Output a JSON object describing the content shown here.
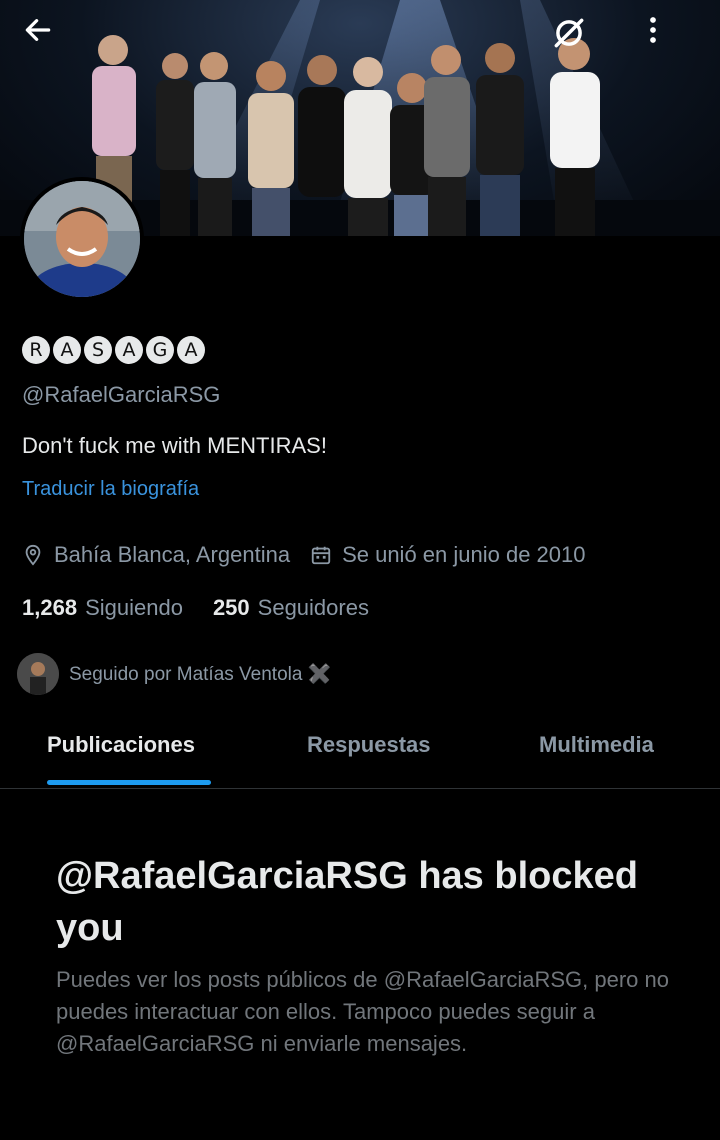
{
  "header": {
    "back_icon": "arrow-left-icon",
    "translate_icon": "translate-slash-icon",
    "more_icon": "more-vertical-icon"
  },
  "profile": {
    "display_name_letters": [
      "R",
      "A",
      "S",
      "A",
      "G",
      "A"
    ],
    "handle": "@RafaelGarciaRSG",
    "bio": "Don't fuck me with MENTIRAS!",
    "translate_link": "Traducir la biografía",
    "location": "Bahía Blanca, Argentina",
    "joined": "Se unió en junio de 2010",
    "following_count": "1,268",
    "following_label": "Siguiendo",
    "followers_count": "250",
    "followers_label": "Seguidores",
    "followed_by": "Seguido por Matías Ventola ✖️"
  },
  "tabs": [
    {
      "label": "Publicaciones",
      "active": true
    },
    {
      "label": "Respuestas",
      "active": false
    },
    {
      "label": "Multimedia",
      "active": false
    }
  ],
  "blocked": {
    "title": "@RafaelGarciaRSG has blocked you",
    "description": "Puedes ver los posts públicos de @RafaelGarciaRSG, pero no puedes interactuar con ellos. Tampoco puedes seguir a @RafaelGarciaRSG ni enviarle mensajes."
  },
  "colors": {
    "background": "#000000",
    "text_primary": "#e7e9ea",
    "text_secondary": "#8b98a5",
    "link": "#3a93dd",
    "accent": "#1d9bf0"
  }
}
